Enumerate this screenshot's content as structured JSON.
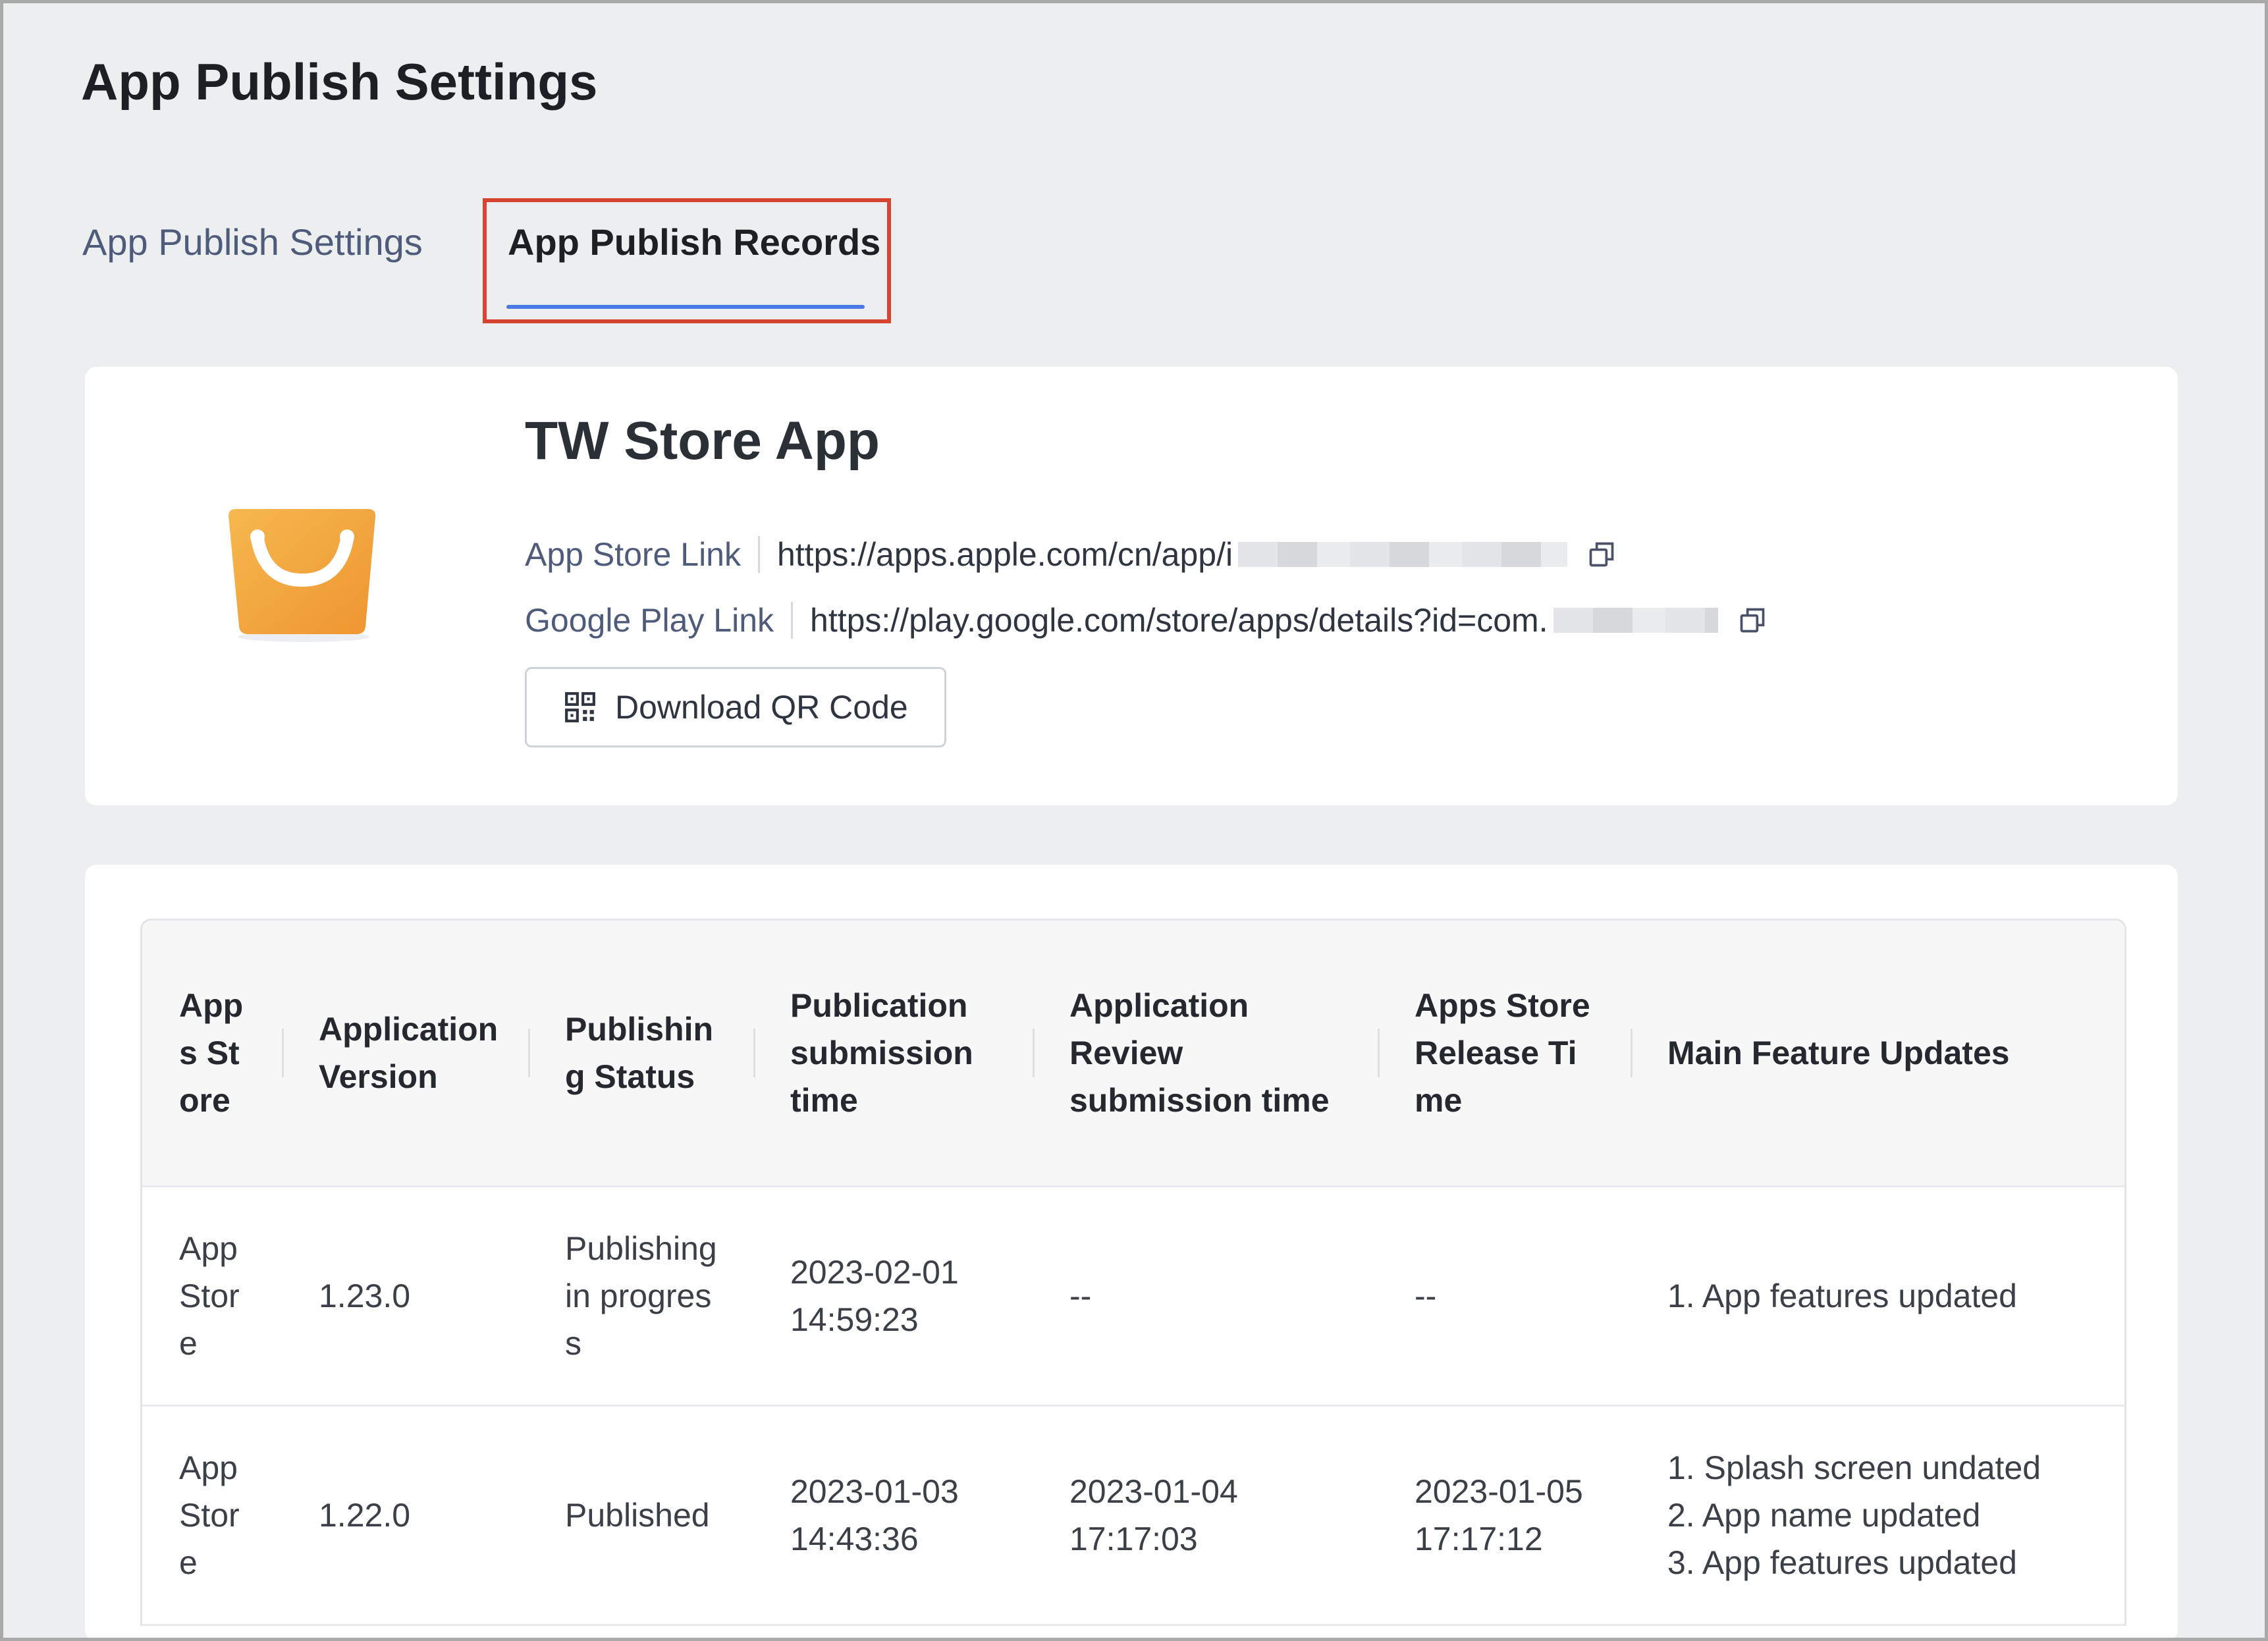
{
  "page": {
    "title": "App Publish Settings"
  },
  "tabs": [
    {
      "label": "App Publish Settings",
      "active": false
    },
    {
      "label": "App Publish Records",
      "active": true
    }
  ],
  "app": {
    "name": "TW Store App",
    "app_store": {
      "label": "App Store Link",
      "url": "https://apps.apple.com/cn/app/i"
    },
    "google_play": {
      "label": "Google Play Link",
      "url": "https://play.google.com/store/apps/details?id=com."
    },
    "qr_button": "Download QR Code",
    "icon": "shopping-bag-icon",
    "icon_color": "#f3a73f"
  },
  "table": {
    "columns": [
      "Apps Store",
      "Application Version",
      "Publishing Status",
      "Publication submission time",
      "Application Review submission time",
      "Apps Store Release Time",
      "Main Feature Updates"
    ],
    "rows": [
      {
        "store": "App Store",
        "version": "1.23.0",
        "status": "Publishing in progress",
        "publication_time": "2023-02-01 14:59:23",
        "review_time": "--",
        "release_time": "--",
        "features": [
          "1. App features updated"
        ]
      },
      {
        "store": "App Store",
        "version": "1.22.0",
        "status": "Published",
        "publication_time": "2023-01-03 14:43:36",
        "review_time": "2023-01-04 17:17:03",
        "release_time": "2023-01-05 17:17:12",
        "features": [
          "1. Splash screen undated",
          "2. App name updated",
          "3. App features updated"
        ]
      }
    ]
  },
  "colors": {
    "accent": "#4a78e6",
    "highlight": "#d94331",
    "background": "#edeef0"
  }
}
